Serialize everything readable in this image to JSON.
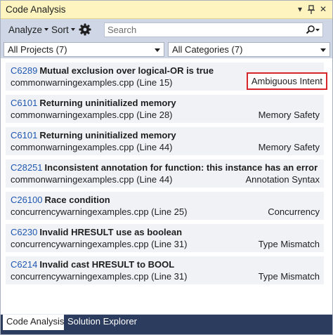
{
  "window": {
    "title": "Code Analysis",
    "dropdown_glyph": "▾",
    "pin_glyph": "⊣",
    "close_glyph": "✕"
  },
  "toolbar": {
    "analyze_label": "Analyze",
    "sort_label": "Sort",
    "settings_icon": "gear-icon",
    "search_placeholder": "Search",
    "search_icon": "search-icon"
  },
  "filters": {
    "project": "All Projects (7)",
    "category": "All Categories (7)"
  },
  "colors": {
    "title_bar": "#fdf4bf",
    "toolbar": "#cfd6e5",
    "code_link": "#1f57b0",
    "highlight_border": "#d6262c",
    "tab_strip": "#2b3c5e"
  },
  "results": [
    {
      "code": "C6289",
      "title": "Mutual exclusion over logical-OR is true",
      "file": "commonwarningexamples.cpp (Line 15)",
      "category": "Ambiguous Intent",
      "highlighted": true
    },
    {
      "code": "C6101",
      "title": "Returning uninitialized memory",
      "file": "commonwarningexamples.cpp (Line 28)",
      "category": "Memory Safety",
      "highlighted": false
    },
    {
      "code": "C6101",
      "title": "Returning uninitialized memory",
      "file": "commonwarningexamples.cpp (Line 44)",
      "category": "Memory Safety",
      "highlighted": false
    },
    {
      "code": "C28251",
      "title": "Inconsistent annotation for function: this instance has an error",
      "file": "commonwarningexamples.cpp (Line 44)",
      "category": "Annotation Syntax",
      "highlighted": false
    },
    {
      "code": "C26100",
      "title": "Race condition",
      "file": "concurrencywarningexamples.cpp (Line 25)",
      "category": "Concurrency",
      "highlighted": false
    },
    {
      "code": "C6230",
      "title": "Invalid HRESULT use as boolean",
      "file": "concurrencywarningexamples.cpp (Line 31)",
      "category": "Type Mismatch",
      "highlighted": false
    },
    {
      "code": "C6214",
      "title": "Invalid cast HRESULT to BOOL",
      "file": "concurrencywarningexamples.cpp (Line 31)",
      "category": "Type Mismatch",
      "highlighted": false
    }
  ],
  "tabs": [
    {
      "label": "Code Analysis",
      "active": true
    },
    {
      "label": "Solution Explorer",
      "active": false
    }
  ]
}
